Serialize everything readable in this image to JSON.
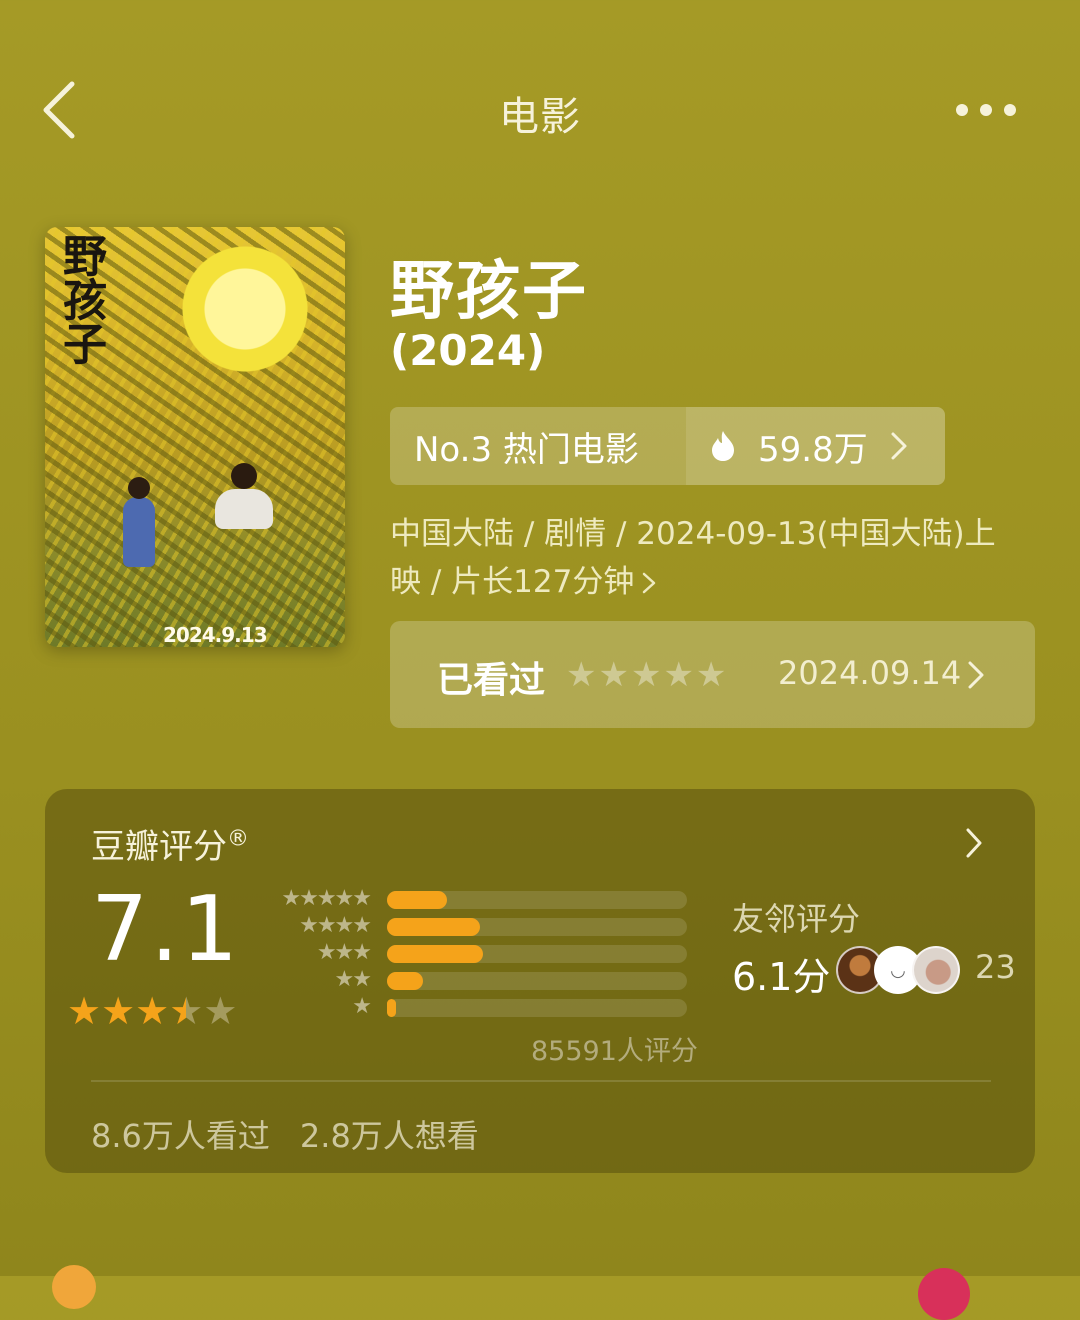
{
  "header": {
    "title": "电影"
  },
  "poster": {
    "title_text": "野孩子",
    "date_text": "2024.9.13"
  },
  "movie": {
    "title": "野孩子",
    "year": "(2024)",
    "rank_label": "No.3 热门电影",
    "heat": "59.8万",
    "meta": "中国大陆 / 剧情 / 2024-09-13(中国大陆)上映 / 片长127分钟"
  },
  "watched": {
    "label": "已看过",
    "stars": "★★★★★",
    "date": "2024.09.14"
  },
  "rating": {
    "title": "豆瓣评分",
    "registered": "®",
    "score": "7.1",
    "stars_value": 3.5,
    "stars_max": 5,
    "distribution": [
      {
        "stars": "★★★★★",
        "fraction": 0.2
      },
      {
        "stars": "★★★★",
        "fraction": 0.31
      },
      {
        "stars": "★★★",
        "fraction": 0.32
      },
      {
        "stars": "★★",
        "fraction": 0.12
      },
      {
        "stars": "★",
        "fraction": 0.03
      }
    ],
    "count": "85591人评分",
    "friend_label": "友邻评分",
    "friend_score": "6.1分",
    "friend_count": "23",
    "watched_count": "8.6万人看过",
    "want_count": "2.8万人想看"
  },
  "colors": {
    "background": "#a59a26",
    "accent": "#f5a31a"
  },
  "icons": [
    "back-arrow-icon",
    "more-dots-icon",
    "flame-icon",
    "chevron-right-icon"
  ]
}
